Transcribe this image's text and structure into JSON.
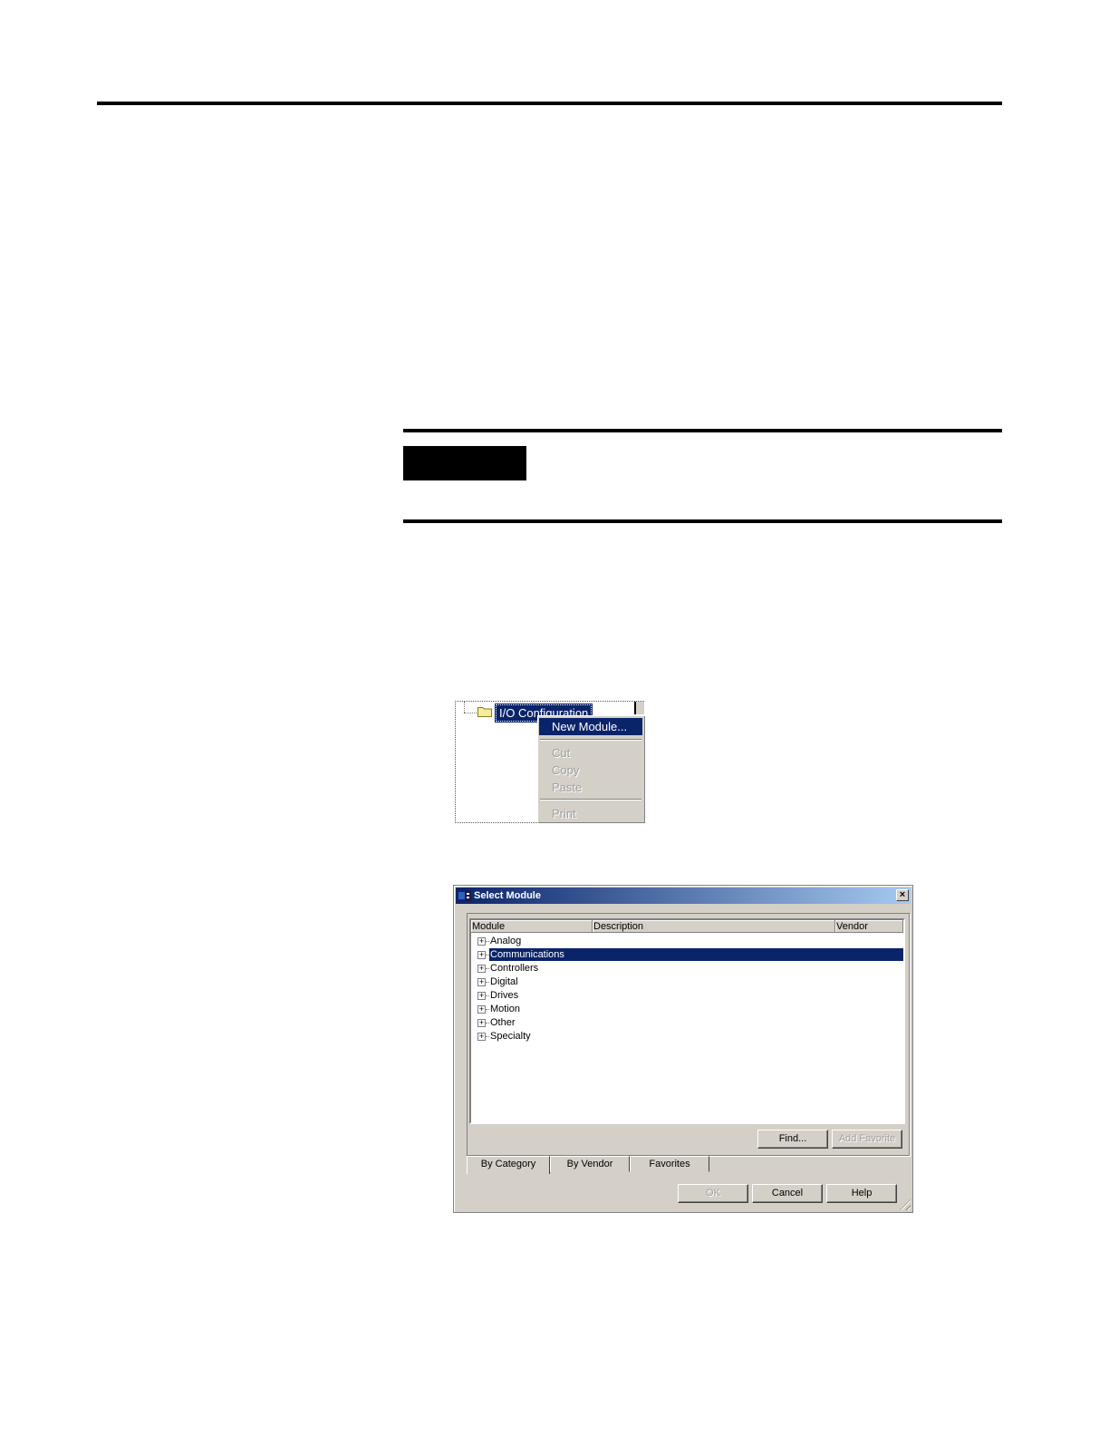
{
  "note": {
    "tag": ""
  },
  "context_menu": {
    "tree_node": "I/O Configuration",
    "items": [
      {
        "label": "New Module...",
        "state": "selected"
      },
      {
        "label": "Cut",
        "state": "disabled"
      },
      {
        "label": "Copy",
        "state": "disabled"
      },
      {
        "label": "Paste",
        "state": "disabled"
      },
      {
        "label": "Print",
        "state": "disabled"
      }
    ]
  },
  "dialog": {
    "title": "Select Module",
    "close_label": "×",
    "columns": [
      "Module",
      "Description",
      "Vendor"
    ],
    "rows": [
      "Analog",
      "Communications",
      "Controllers",
      "Digital",
      "Drives",
      "Motion",
      "Other",
      "Specialty"
    ],
    "selected_row": "Communications",
    "buttons": {
      "find": "Find...",
      "add_favorite": "Add Favorite",
      "ok": "OK",
      "cancel": "Cancel",
      "help": "Help"
    },
    "tabs": [
      "By Category",
      "By Vendor",
      "Favorites"
    ],
    "active_tab": "By Category"
  },
  "colors": {
    "highlight": "#0a246a",
    "face": "#d4d0c8"
  }
}
